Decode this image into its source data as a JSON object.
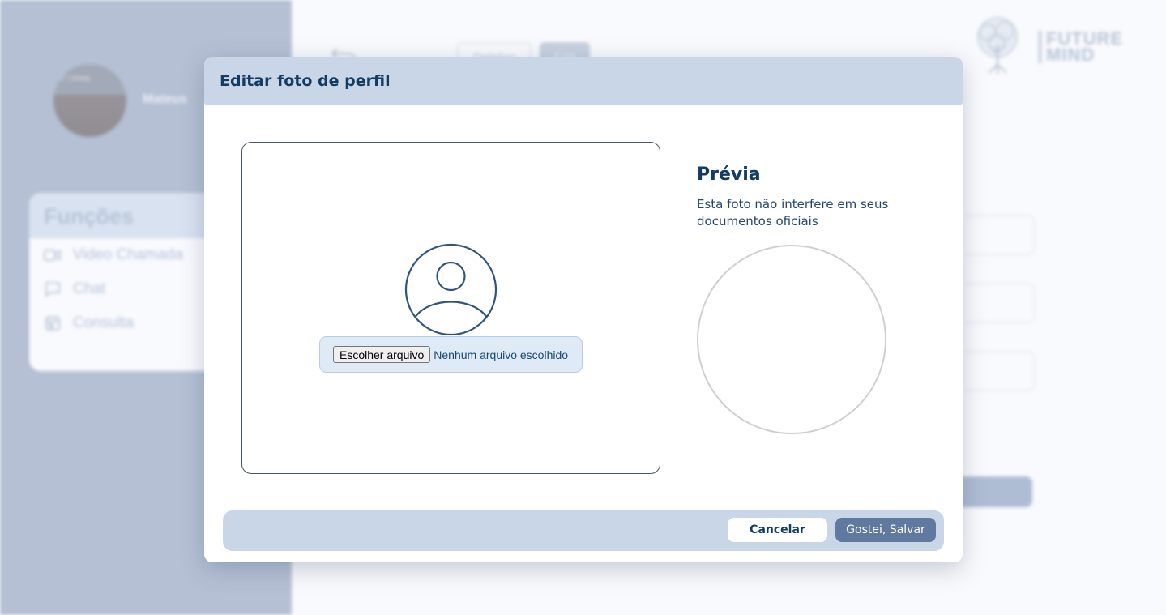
{
  "background": {
    "user": {
      "avatar_caption": "se\" | Unesp",
      "name": "Mateus"
    },
    "functions": {
      "title": "Funções",
      "items": [
        {
          "label": "Video Chamada",
          "icon": "video-camera-icon"
        },
        {
          "label": "Chat",
          "icon": "chat-bubble-icon"
        },
        {
          "label": "Consulta",
          "icon": "calendar-icon"
        }
      ]
    },
    "top_buttons": {
      "ghost_label": "Deletar",
      "filled_label": "Edit"
    },
    "logo": {
      "line1": "FUTURE",
      "line2": "MIND",
      "icon": "tree-icon"
    }
  },
  "modal": {
    "title": "Editar foto de perfil",
    "upload": {
      "icon": "user-avatar-icon",
      "choose_button": "Escolher arquivo",
      "status": "Nenhum arquivo escolhido"
    },
    "preview": {
      "title": "Prévia",
      "description": "Esta foto não interfere em seus documentos oficiais"
    },
    "footer": {
      "cancel_label": "Cancelar",
      "save_label": "Gostei, Salvar"
    }
  },
  "colors": {
    "header_bg": "#c8d6e8",
    "title_text": "#143c62",
    "primary_button": "#60799f",
    "sidebar_bg": "#8a9bb8",
    "file_picker_bg": "#deebf7"
  }
}
